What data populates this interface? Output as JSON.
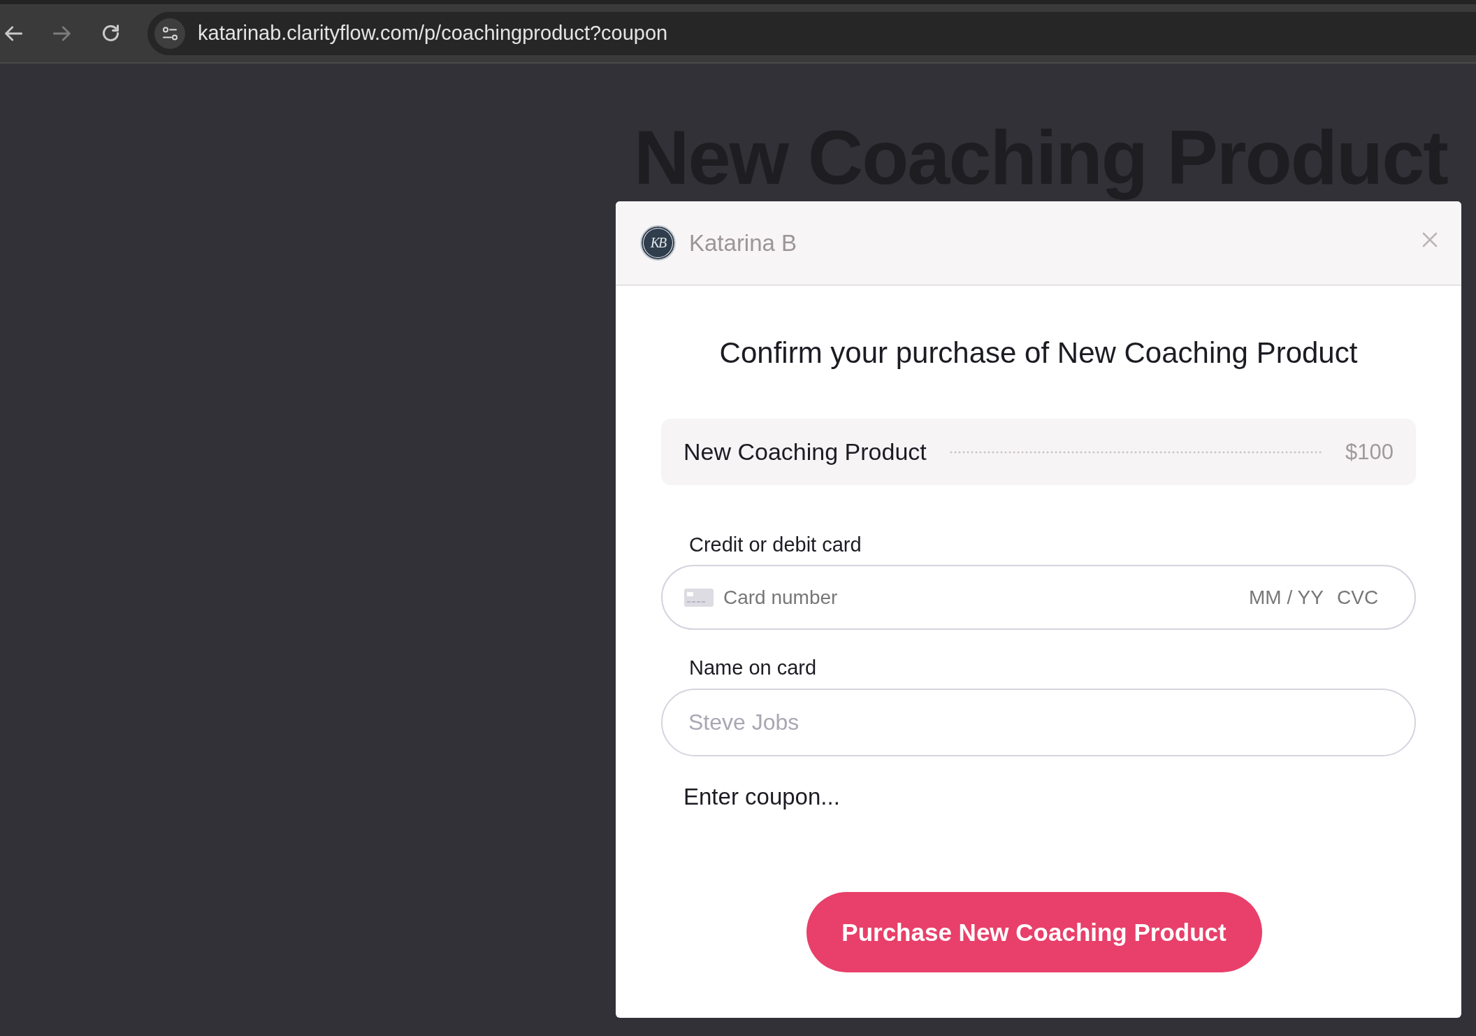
{
  "browser": {
    "nav": [
      {
        "kind": "back",
        "disabled": false
      },
      {
        "kind": "forward",
        "disabled": true
      },
      {
        "kind": "reload",
        "disabled": false
      }
    ],
    "url": "katarinab.clarityflow.com/p/coachingproduct?coupon"
  },
  "page": {
    "heading": "New Coaching Product"
  },
  "modal": {
    "header": {
      "avatar_monogram": "KB",
      "name": "Katarina B"
    },
    "title": "Confirm your purchase of New Coaching Product",
    "order_item": {
      "name": "New Coaching Product",
      "price": "$100"
    },
    "card_field": {
      "label": "Credit or debit card",
      "number_placeholder": "Card number",
      "expiry_placeholder": "MM / YY",
      "cvc_placeholder": "CVC"
    },
    "name_field": {
      "label": "Name on card",
      "placeholder": "Steve Jobs"
    },
    "coupon_link": "Enter coupon...",
    "purchase_button": "Purchase New Coaching Product"
  }
}
